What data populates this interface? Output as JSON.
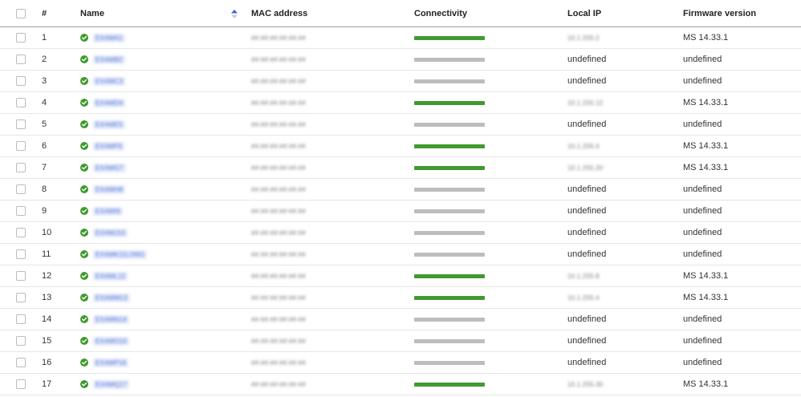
{
  "colors": {
    "connected": "#3f9a2f",
    "disconnected": "#bdbdbd",
    "status_ok": "#3f9a2f",
    "link": "#4a6fd8",
    "header_border": "#9b9b9b",
    "row_border": "#e6e6e6"
  },
  "icons": {
    "sort": "sort-ascending-icon",
    "status": "check-circle-icon"
  },
  "headers": {
    "select": "",
    "num": "#",
    "name": "Name",
    "mac": "MAC address",
    "connectivity": "Connectivity",
    "local_ip": "Local IP",
    "firmware": "Firmware version"
  },
  "rows": [
    {
      "num": "1",
      "name": "EXAMA1",
      "mac": "##:##:##:##:##:##",
      "connected": true,
      "local_ip": "10.1.200.2",
      "firmware": "MS 14.33.1"
    },
    {
      "num": "2",
      "name": "EXAMB2",
      "mac": "##:##:##:##:##:##",
      "connected": false,
      "local_ip": "undefined",
      "firmware": "undefined"
    },
    {
      "num": "3",
      "name": "EXAMC3",
      "mac": "##:##:##:##:##:##",
      "connected": false,
      "local_ip": "undefined",
      "firmware": "undefined"
    },
    {
      "num": "4",
      "name": "EXAMD4",
      "mac": "##:##:##:##:##:##",
      "connected": true,
      "local_ip": "10.1.255.12",
      "firmware": "MS 14.33.1"
    },
    {
      "num": "5",
      "name": "EXAME5",
      "mac": "##:##:##:##:##:##",
      "connected": false,
      "local_ip": "undefined",
      "firmware": "undefined"
    },
    {
      "num": "6",
      "name": "EXAMF6",
      "mac": "##:##:##:##:##:##",
      "connected": true,
      "local_ip": "10.1.200.4",
      "firmware": "MS 14.33.1"
    },
    {
      "num": "7",
      "name": "EXAMG7",
      "mac": "##:##:##:##:##:##",
      "connected": true,
      "local_ip": "10.1.255.20",
      "firmware": "MS 14.33.1"
    },
    {
      "num": "8",
      "name": "EXAMH8",
      "mac": "##:##:##:##:##:##",
      "connected": false,
      "local_ip": "undefined",
      "firmware": "undefined"
    },
    {
      "num": "9",
      "name": "EXAMI9",
      "mac": "##:##:##:##:##:##",
      "connected": false,
      "local_ip": "undefined",
      "firmware": "undefined"
    },
    {
      "num": "10",
      "name": "EXAMJ10",
      "mac": "##:##:##:##:##:##",
      "connected": false,
      "local_ip": "undefined",
      "firmware": "undefined"
    },
    {
      "num": "11",
      "name": "EXAMK11LONG",
      "mac": "##:##:##:##:##:##",
      "connected": false,
      "local_ip": "undefined",
      "firmware": "undefined"
    },
    {
      "num": "12",
      "name": "EXAML12",
      "mac": "##:##:##:##:##:##",
      "connected": true,
      "local_ip": "10.1.255.8",
      "firmware": "MS 14.33.1"
    },
    {
      "num": "13",
      "name": "EXAMM13",
      "mac": "##:##:##:##:##:##",
      "connected": true,
      "local_ip": "10.1.255.4",
      "firmware": "MS 14.33.1"
    },
    {
      "num": "14",
      "name": "EXAMN14",
      "mac": "##:##:##:##:##:##",
      "connected": false,
      "local_ip": "undefined",
      "firmware": "undefined"
    },
    {
      "num": "15",
      "name": "EXAMO15",
      "mac": "##:##:##:##:##:##",
      "connected": false,
      "local_ip": "undefined",
      "firmware": "undefined"
    },
    {
      "num": "16",
      "name": "EXAMP16",
      "mac": "##:##:##:##:##:##",
      "connected": false,
      "local_ip": "undefined",
      "firmware": "undefined"
    },
    {
      "num": "17",
      "name": "EXAMQ17",
      "mac": "##:##:##:##:##:##",
      "connected": true,
      "local_ip": "10.1.255.30",
      "firmware": "MS 14.33.1"
    }
  ]
}
